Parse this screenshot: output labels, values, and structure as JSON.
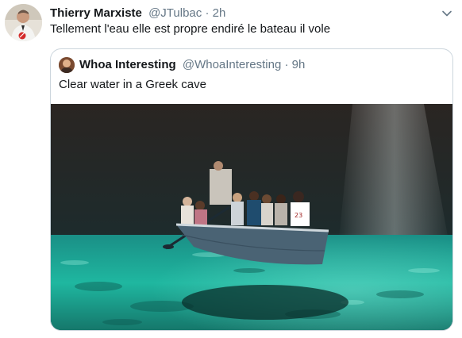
{
  "tweet": {
    "display_name": "Thierry Marxiste",
    "handle": "@JTulbac",
    "separator": "·",
    "time": "2h",
    "text": "Tellement l'eau elle est propre endiré le bateau il vole",
    "avatar_icon": "user-avatar",
    "menu_icon": "chevron-down-icon"
  },
  "quoted_tweet": {
    "display_name": "Whoa Interesting",
    "handle": "@WhoaInteresting",
    "separator": "·",
    "time": "9h",
    "text": "Clear water in a Greek cave",
    "avatar_icon": "user-avatar"
  },
  "colors": {
    "text_primary": "#14171a",
    "text_secondary": "#657786",
    "border": "#ccd6dd",
    "water": "#1fb7a0"
  }
}
